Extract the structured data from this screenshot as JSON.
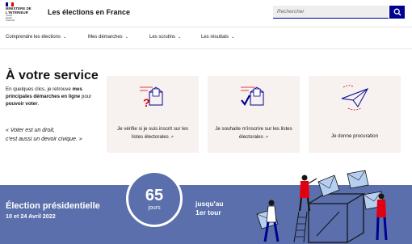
{
  "header": {
    "ministry_line1": "MINISTÈRE DE",
    "ministry_line2": "L'INTÉRIEUR",
    "motto_line1": "Liberté",
    "motto_line2": "Égalité",
    "motto_line3": "Fraternité",
    "site_title": "Les élections en France",
    "search_placeholder": "Rechercher",
    "search_icon": "search-icon",
    "flag_colors": [
      "#000091",
      "#ffffff",
      "#e1000f"
    ]
  },
  "nav": {
    "items": [
      {
        "label": "Comprendre les élections"
      },
      {
        "label": "Mes démarches"
      },
      {
        "label": "Les scrutins"
      },
      {
        "label": "Les résultats"
      }
    ],
    "chevron": "⌄"
  },
  "service": {
    "title": "À votre service",
    "desc_part1": "En quelques clics, je retrouve ",
    "desc_bold1": "mes principales démarches en ligne",
    "desc_part2": " pour ",
    "desc_bold2": "pouvoir voter",
    "desc_part3": ".",
    "quote_line1": "« Voter est un droit,",
    "quote_line2": "c'est aussi un devoir civique. »"
  },
  "cards": [
    {
      "label": "Je vérifie si je suis inscrit sur les listes électorales",
      "icon": "ballot-question-icon",
      "external": true
    },
    {
      "label": "Je souhaite m'inscrire sur les listes électorales",
      "icon": "ballot-check-icon",
      "external": true
    },
    {
      "label": "Je donne procuration",
      "icon": "paper-plane-icon",
      "external": false
    }
  ],
  "banner": {
    "title": "Élection présidentielle",
    "dates": "10 et 24 Avril 2022",
    "days_value": "65",
    "days_unit": "jours",
    "until_line1": "jusqu'au",
    "until_line2": "1er tour",
    "background": "#5a6fab"
  },
  "colors": {
    "accent": "#000091",
    "card_bg": "#f7f2ef",
    "red": "#e1000f"
  }
}
